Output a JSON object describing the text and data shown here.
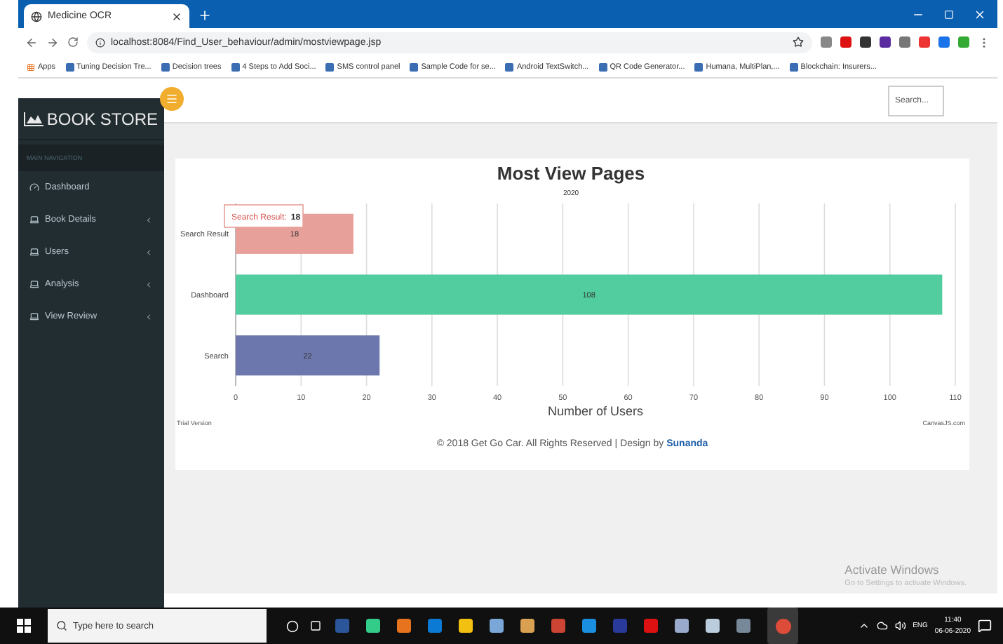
{
  "browser": {
    "tab": {
      "title": "Medicine OCR"
    },
    "url": "localhost:8084/Find_User_behaviour/admin/mostviewpage.jsp",
    "bookmarks": [
      "Apps",
      "Tuning Decision Tre...",
      "Decision trees",
      "4 Steps to Add Soci...",
      "SMS control panel",
      "Sample Code for se...",
      "Android TextSwitch...",
      "QR Code Generator...",
      "Humana, MultiPlan,...",
      "Blockchain: Insurers..."
    ]
  },
  "sidebar": {
    "brand": "BOOK STORE",
    "section": "MAIN NAVIGATION",
    "items": [
      {
        "label": "Dashboard",
        "has_submenu": false
      },
      {
        "label": "Book Details",
        "has_submenu": true
      },
      {
        "label": "Users",
        "has_submenu": true
      },
      {
        "label": "Analysis",
        "has_submenu": true
      },
      {
        "label": "View Review",
        "has_submenu": true
      }
    ]
  },
  "header": {
    "search": {
      "placeholder": "Search..."
    }
  },
  "chart_data": {
    "type": "bar",
    "orientation": "horizontal",
    "title": "Most View Pages",
    "subtitle": "2020",
    "xlabel": "Number of Users",
    "categories": [
      "Search Result",
      "Dashboard",
      "Search"
    ],
    "values": [
      18,
      108,
      22
    ],
    "colors": [
      "#e8a09a",
      "#52cd9f",
      "#6c78ad"
    ],
    "xlim": [
      0,
      110
    ],
    "xticks": [
      0,
      10,
      20,
      30,
      40,
      50,
      60,
      70,
      80,
      90,
      100,
      110
    ],
    "value_labels": [
      "18",
      "108",
      "22"
    ],
    "grid": true
  },
  "chart_overlay": {
    "tooltip": {
      "label": "Search Result:",
      "value": "18"
    },
    "trial": "Trial Version",
    "credit": "CanvasJS.com"
  },
  "footer": {
    "text": "© 2018 Get Go Car. All Rights Reserved | Design by",
    "link": "Sunanda"
  },
  "activation": {
    "title": "Activate Windows",
    "text": "Go to Settings to activate Windows."
  },
  "taskbar": {
    "search": {
      "placeholder": "Type here to search"
    },
    "language": "ENG",
    "time": "11:40",
    "date": "06-06-2020"
  }
}
